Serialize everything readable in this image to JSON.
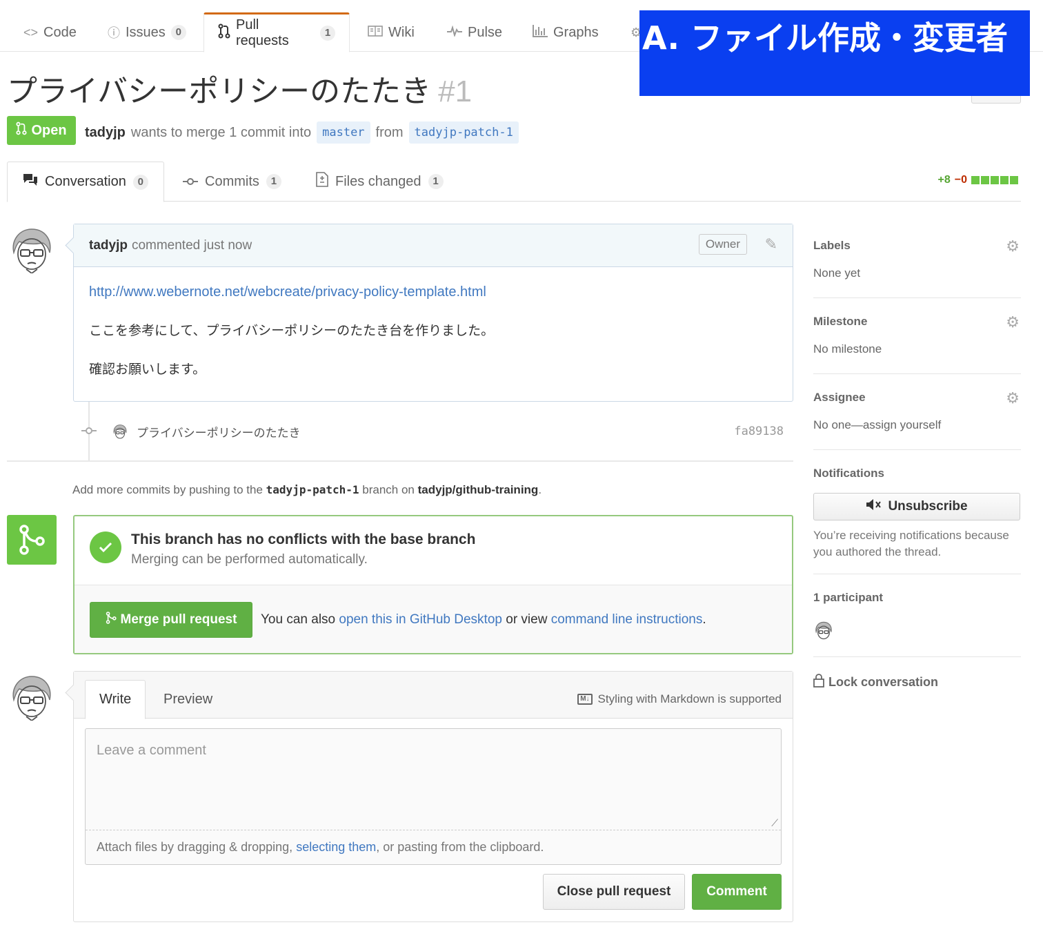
{
  "repo_nav": {
    "tabs": [
      {
        "label": "Code",
        "icon": "code-icon"
      },
      {
        "label": "Issues",
        "count": "0",
        "icon": "issue-icon"
      },
      {
        "label": "Pull requests",
        "count": "1",
        "icon": "pull-request-icon",
        "selected": true
      },
      {
        "label": "Wiki",
        "icon": "book-icon"
      },
      {
        "label": "Pulse",
        "icon": "pulse-icon"
      },
      {
        "label": "Graphs",
        "icon": "graph-icon"
      }
    ]
  },
  "banner": {
    "text": "A. ファイル作成・変更者",
    "color": "#0a3ff0"
  },
  "pr": {
    "title": "プライバシーポリシーのたたき",
    "number": "#1",
    "state": "Open",
    "author": "tadyjp",
    "merge_text_1": "wants to merge 1 commit into",
    "base_branch": "master",
    "merge_text_2": "from",
    "head_branch": "tadyjp-patch-1"
  },
  "pr_tabs": [
    {
      "label": "Conversation",
      "count": "0",
      "icon": "conversation-icon"
    },
    {
      "label": "Commits",
      "count": "1",
      "icon": "commit-icon"
    },
    {
      "label": "Files changed",
      "count": "1",
      "icon": "file-diff-icon"
    }
  ],
  "diffstat": {
    "additions": "+8",
    "deletions": "−0"
  },
  "comment": {
    "author": "tadyjp",
    "action": "commented just now",
    "badge": "Owner",
    "link": "http://www.webernote.net/webcreate/privacy-policy-template.html",
    "body_1": "ここを参考にして、プライバシーポリシーのたたき台を作りました。",
    "body_2": "確認お願いします。"
  },
  "commit": {
    "message": "プライバシーポリシーのたたき",
    "sha": "fa89138"
  },
  "add_more": {
    "prefix": "Add more commits by pushing to the",
    "branch": "tadyjp-patch-1",
    "middle": "branch on",
    "repo": "tadyjp/github-training",
    "suffix": "."
  },
  "merge": {
    "heading": "This branch has no conflicts with the base branch",
    "sub": "Merging can be performed automatically.",
    "button": "Merge pull request",
    "alt_prefix": "You can also",
    "alt_link1": "open this in GitHub Desktop",
    "alt_middle": "or view",
    "alt_link2": "command line instructions",
    "alt_suffix": "."
  },
  "new_comment": {
    "tab_write": "Write",
    "tab_preview": "Preview",
    "markdown_note": "Styling with Markdown is supported",
    "placeholder": "Leave a comment",
    "attach_prefix": "Attach files by dragging & dropping,",
    "attach_link": "selecting them",
    "attach_suffix": ", or pasting from the clipboard.",
    "close_button": "Close pull request",
    "comment_button": "Comment"
  },
  "sidebar": {
    "labels_heading": "Labels",
    "labels_value": "None yet",
    "milestone_heading": "Milestone",
    "milestone_value": "No milestone",
    "assignee_heading": "Assignee",
    "assignee_value": "No one—assign yourself",
    "notifications_heading": "Notifications",
    "unsubscribe_button": "Unsubscribe",
    "notifications_note": "You’re receiving notifications because you authored the thread.",
    "participants_heading": "1 participant",
    "lock_label": "Lock conversation"
  },
  "colors": {
    "green": "#6cc644",
    "link": "#4078c0",
    "accent_tab": "#d26911"
  }
}
